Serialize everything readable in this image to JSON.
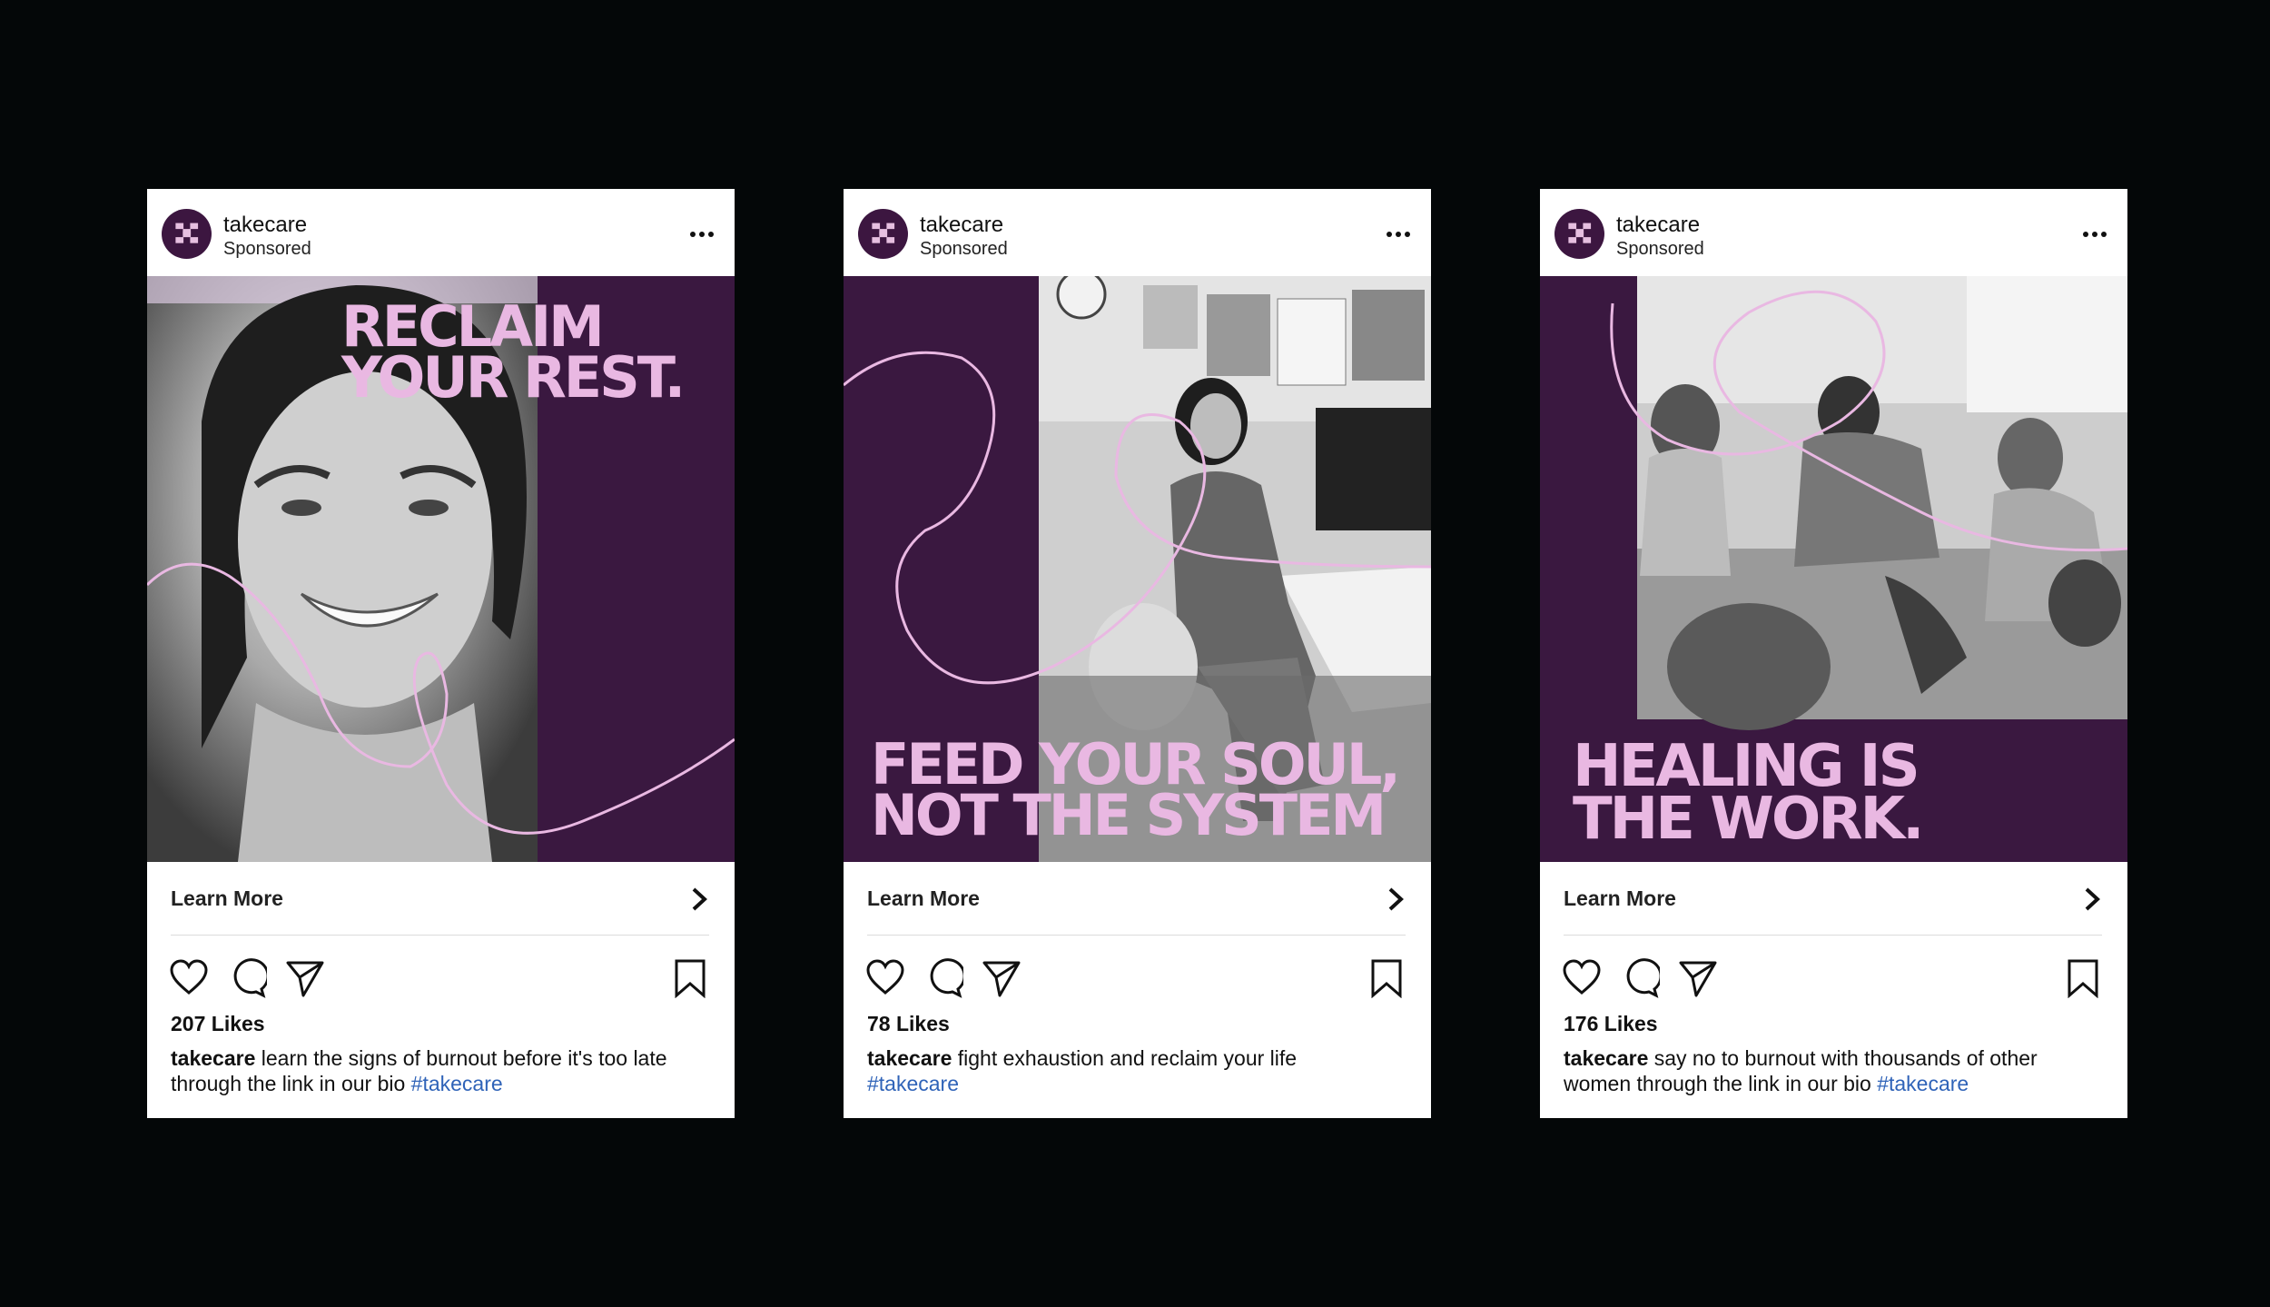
{
  "posts": [
    {
      "account": "takecare",
      "sponsored": "Sponsored",
      "headline_line1": "RECLAIM",
      "headline_line2": "YOUR REST.",
      "image_alt": "smiling woman portrait",
      "cta": "Learn More",
      "likes": "207 Likes",
      "caption_user": "takecare",
      "caption_text": " learn the signs of burnout before it's too late through the link in our bio ",
      "hashtag": "#takecare"
    },
    {
      "account": "takecare",
      "sponsored": "Sponsored",
      "headline_line1": "FEED YOUR SOUL,",
      "headline_line2": "NOT THE SYSTEM",
      "image_alt": "woman smiling at office desk",
      "cta": "Learn More",
      "likes": "78 Likes",
      "caption_user": "takecare",
      "caption_text": " fight exhaustion and reclaim your life ",
      "hashtag": "#takecare"
    },
    {
      "account": "takecare",
      "sponsored": "Sponsored",
      "headline_line1": "HEALING IS",
      "headline_line2": "THE WORK.",
      "image_alt": "group of women embracing in a living room",
      "cta": "Learn More",
      "likes": "176 Likes",
      "caption_user": "takecare",
      "caption_text": " say no to burnout with thousands of other women through the link in our bio ",
      "hashtag": "#takecare"
    }
  ],
  "colors": {
    "background": "#040708",
    "brand_purple": "#3a1840",
    "brand_pink": "#e9b8e2",
    "hashtag_blue": "#2f63b8"
  }
}
